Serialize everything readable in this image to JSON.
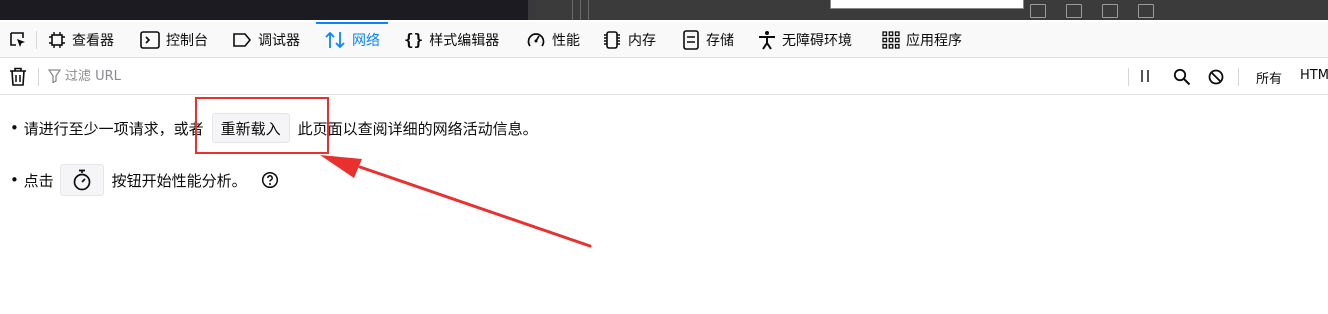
{
  "colors": {
    "accent": "#0a84ff",
    "highlight": "#e8302f"
  },
  "tabs": [
    {
      "label": "查看器",
      "icon": "inspector-icon"
    },
    {
      "label": "控制台",
      "icon": "console-icon"
    },
    {
      "label": "调试器",
      "icon": "debugger-icon"
    },
    {
      "label": "网络",
      "icon": "network-icon",
      "selected": true
    },
    {
      "label": "样式编辑器",
      "icon": "style-editor-icon"
    },
    {
      "label": "性能",
      "icon": "performance-icon"
    },
    {
      "label": "内存",
      "icon": "memory-icon"
    },
    {
      "label": "存储",
      "icon": "storage-icon"
    },
    {
      "label": "无障碍环境",
      "icon": "accessibility-icon"
    },
    {
      "label": "应用程序",
      "icon": "application-icon"
    }
  ],
  "filterbar": {
    "placeholder": "过滤 URL",
    "type_all": "所有",
    "type_html": "HTML"
  },
  "notice": {
    "line1_before": "请进行至少一项请求，或者",
    "reload_button": "重新载入",
    "line1_after": "此页面以查阅详细的网络活动信息。",
    "line2_before": "点击",
    "line2_after": "按钮开始性能分析。"
  }
}
